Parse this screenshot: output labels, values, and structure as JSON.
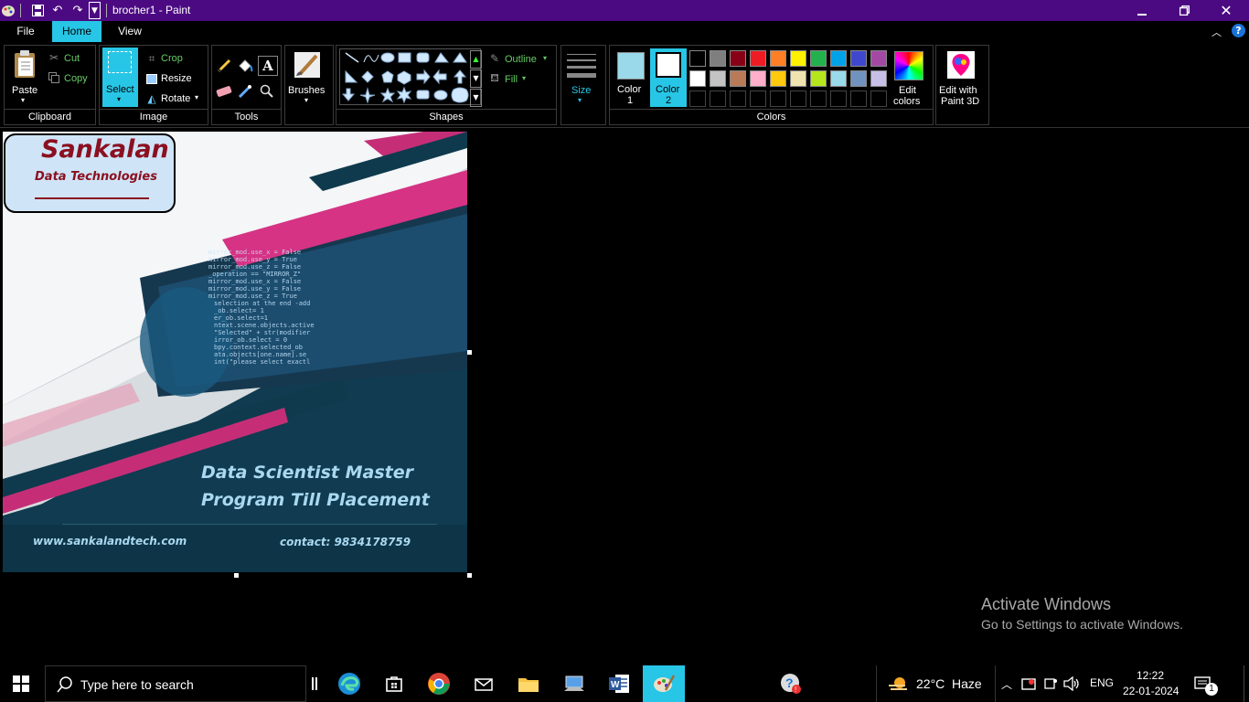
{
  "window": {
    "title": "brocher1 - Paint"
  },
  "tabs": [
    {
      "label": "File"
    },
    {
      "label": "Home"
    },
    {
      "label": "View"
    }
  ],
  "ribbon": {
    "clipboard": {
      "paste": "Paste",
      "cut": "Cut",
      "copy": "Copy",
      "group": "Clipboard"
    },
    "image": {
      "select": "Select",
      "crop": "Crop",
      "resize": "Resize",
      "rotate": "Rotate",
      "group": "Image"
    },
    "tools": {
      "group": "Tools"
    },
    "brushes": {
      "label": "Brushes"
    },
    "shapes": {
      "outline": "Outline",
      "fill": "Fill",
      "group": "Shapes"
    },
    "size": {
      "label": "Size"
    },
    "colors": {
      "color1_line1": "Color",
      "color1_line2": "1",
      "color2_line1": "Color",
      "color2_line2": "2",
      "edit_line1": "Edit",
      "edit_line2": "colors",
      "group": "Colors",
      "color1": "#99d9ea",
      "color2": "#ffffff",
      "palette_row1": [
        "#000000",
        "#7f7f7f",
        "#880015",
        "#ed1c24",
        "#ff7f27",
        "#fff200",
        "#22b14c",
        "#00a2e8",
        "#3f48cc",
        "#a349a4"
      ],
      "palette_row2": [
        "#ffffff",
        "#c3c3c3",
        "#b97a57",
        "#ffaec9",
        "#ffc90e",
        "#efe4b0",
        "#b5e61d",
        "#99d9ea",
        "#7092be",
        "#c8bfe7"
      ]
    },
    "paint3d": {
      "line1": "Edit with",
      "line2": "Paint 3D"
    }
  },
  "canvas_image": {
    "logo_line1": "Sankalan",
    "logo_line2": "Data Technologies",
    "headline_line1": "Data Scientist Master",
    "headline_line2": "Program Till Placement",
    "website": "www.sankalandtech.com",
    "contact": "contact: 9834178759",
    "code_lines": [
      "mirror_mod.use_x = False",
      "mirror_mod.use_y = True",
      "mirror_mod.use_z = False",
      "_operation == \"MIRROR_Z\"",
      "mirror_mod.use_x = False",
      "mirror_mod.use_y = False",
      "mirror_mod.use_z = True",
      "selection at the end -add",
      "_ob.select= 1",
      "er_ob.select=1",
      "ntext.scene.objects.active",
      "\"Selected\" + str(modifier",
      "irror_ob.select = 0",
      "bpy.context.selected_ob",
      "ata.objects[one.name].se",
      "int(\"please select exactl"
    ]
  },
  "watermark": {
    "line1": "Activate Windows",
    "line2": "Go to Settings to activate Windows."
  },
  "taskbar": {
    "search_placeholder": "Type here to search",
    "weather_temp": "22°C",
    "weather_desc": "Haze",
    "language": "ENG",
    "time": "12:22",
    "date": "22-01-2024",
    "notification_count": "1"
  }
}
